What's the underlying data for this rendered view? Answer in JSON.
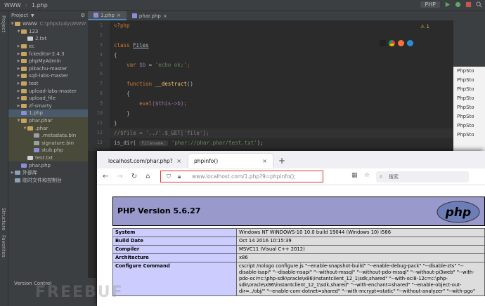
{
  "ide": {
    "titlebar": {
      "project": "WWW",
      "file": "1.php",
      "run_config": "PHP"
    },
    "left_stripe": [
      "Project",
      "Structure",
      "Favorites"
    ],
    "project_panel": {
      "title": "Project"
    },
    "tree": [
      {
        "label": "WWW",
        "suffix": "C:\\phpstudy\\WWW",
        "indent": 0,
        "type": "fold",
        "arrow": "v"
      },
      {
        "label": "123",
        "indent": 1,
        "type": "fold",
        "arrow": "v"
      },
      {
        "label": "2.txt",
        "indent": 2,
        "type": "filetxt",
        "arrow": ""
      },
      {
        "label": "ec",
        "indent": 1,
        "type": "fold",
        "arrow": ">"
      },
      {
        "label": "fckeditor-2.4.3",
        "indent": 1,
        "type": "fold",
        "arrow": ">"
      },
      {
        "label": "phpMyAdmin",
        "indent": 1,
        "type": "fold",
        "arrow": ">"
      },
      {
        "label": "pikachu-master",
        "indent": 1,
        "type": "fold",
        "arrow": ">"
      },
      {
        "label": "sqli-labs-master",
        "indent": 1,
        "type": "fold",
        "arrow": ">"
      },
      {
        "label": "test",
        "indent": 1,
        "type": "fold",
        "arrow": ">"
      },
      {
        "label": "upload-labs-master",
        "indent": 1,
        "type": "fold",
        "arrow": ">"
      },
      {
        "label": "upload_file",
        "indent": 1,
        "type": "fold",
        "arrow": ">"
      },
      {
        "label": "zf-smarty",
        "indent": 1,
        "type": "fold",
        "arrow": ">"
      },
      {
        "label": "1.php",
        "indent": 1,
        "type": "filephp",
        "arrow": ""
      },
      {
        "label": "phar.phar",
        "indent": 1,
        "type": "fold",
        "arrow": "v"
      },
      {
        "label": ".phar",
        "indent": 2,
        "type": "fold",
        "arrow": "v"
      },
      {
        "label": ".metadata.bin",
        "indent": 3,
        "type": "filebin",
        "arrow": ""
      },
      {
        "label": "signature.bin",
        "indent": 3,
        "type": "filebin",
        "arrow": ""
      },
      {
        "label": "stub.php",
        "indent": 3,
        "type": "filephp",
        "arrow": ""
      },
      {
        "label": "test.txt",
        "indent": 2,
        "type": "filetxt",
        "arrow": ""
      },
      {
        "label": "phar.php",
        "indent": 1,
        "type": "filephp",
        "arrow": ""
      },
      {
        "label": "外部库",
        "indent": 0,
        "type": "lib",
        "arrow": ">"
      },
      {
        "label": "临时文件和控制台",
        "indent": 0,
        "type": "lib",
        "arrow": ""
      }
    ],
    "statusbar": {
      "version_control": "Version Control"
    },
    "tabs": [
      {
        "label": "1.php",
        "active": true
      },
      {
        "label": "phar.php",
        "active": false
      }
    ],
    "warning": "1",
    "line_numbers": [
      "1",
      "2",
      "3",
      "4",
      "5",
      "6",
      "7",
      "8",
      "9",
      "10",
      "11",
      "12",
      "13"
    ],
    "code": {
      "l1": "<?php",
      "l3_kw": "class ",
      "l3_name": "Files",
      "l4": "{",
      "l5_kw": "var ",
      "l5_var": "$b",
      "l5_eq": " = ",
      "l5_str": "'echo ok;'",
      "l5_end": ";",
      "l7_kw": "function ",
      "l7_fn": "__destruct",
      "l7_end": "()",
      "l8": "{",
      "l9_fn": "eval",
      "l9_var": "($this->b)",
      "l9_end": ";",
      "l10": "}",
      "l11": "}",
      "l12": "//$file = '../'.$_GET['file'];",
      "l13_fn": "is_dir(",
      "l13_hint": "filename:",
      "l13_str": "'phar://phar.phar/test.txt'",
      "l13_end": ");"
    },
    "right_menu": [
      "PhpSto",
      "PhpSto",
      "PhpSto",
      "PhpSto",
      "PhpSto",
      "PhpSto",
      "PhpSto",
      "PhpSto"
    ]
  },
  "browser": {
    "tabs": [
      {
        "label": "localhost.com/phar.php?",
        "active": false
      },
      {
        "label": "phpinfo()",
        "active": true
      }
    ],
    "url_prefix": "www.localhost.com",
    "url_path": "/1.php?9=phpinfo();",
    "search_placeholder": "搜索",
    "php_version": "PHP Version 5.6.27",
    "php_logo": "php",
    "info_rows": [
      {
        "k": "System",
        "v": "Windows NT WINDOWS-10 10.0 build 19044 (Windows 10) i586"
      },
      {
        "k": "Build Date",
        "v": "Oct 14 2016 10:15:39"
      },
      {
        "k": "Compiler",
        "v": "MSVC11 (Visual C++ 2012)"
      },
      {
        "k": "Architecture",
        "v": "x86"
      },
      {
        "k": "Configure Command",
        "v": "cscript /nologo configure.js \"--enable-snapshot-build\" \"--enable-debug-pack\" \"--disable-zts\" \"--disable-isapi\" \"--disable-nsapi\" \"--without-mssql\" \"--without-pdo-mssql\" \"--without-pi3web\" \"--with-pdo-oci=c:\\php-sdk\\oracle\\x86\\instantclient_12_1\\sdk,shared\" \"--with-oci8-12c=c:\\php-sdk\\oracle\\x86\\instantclient_12_1\\sdk,shared\" \"--with-enchant=shared\" \"--enable-object-out-dir=../obj/\" \"--enable-com-dotnet=shared\" \"--with-mcrypt=static\" \"--without-analyzer\" \"--with-pgo\""
      }
    ]
  },
  "watermark": "FREEBUF"
}
